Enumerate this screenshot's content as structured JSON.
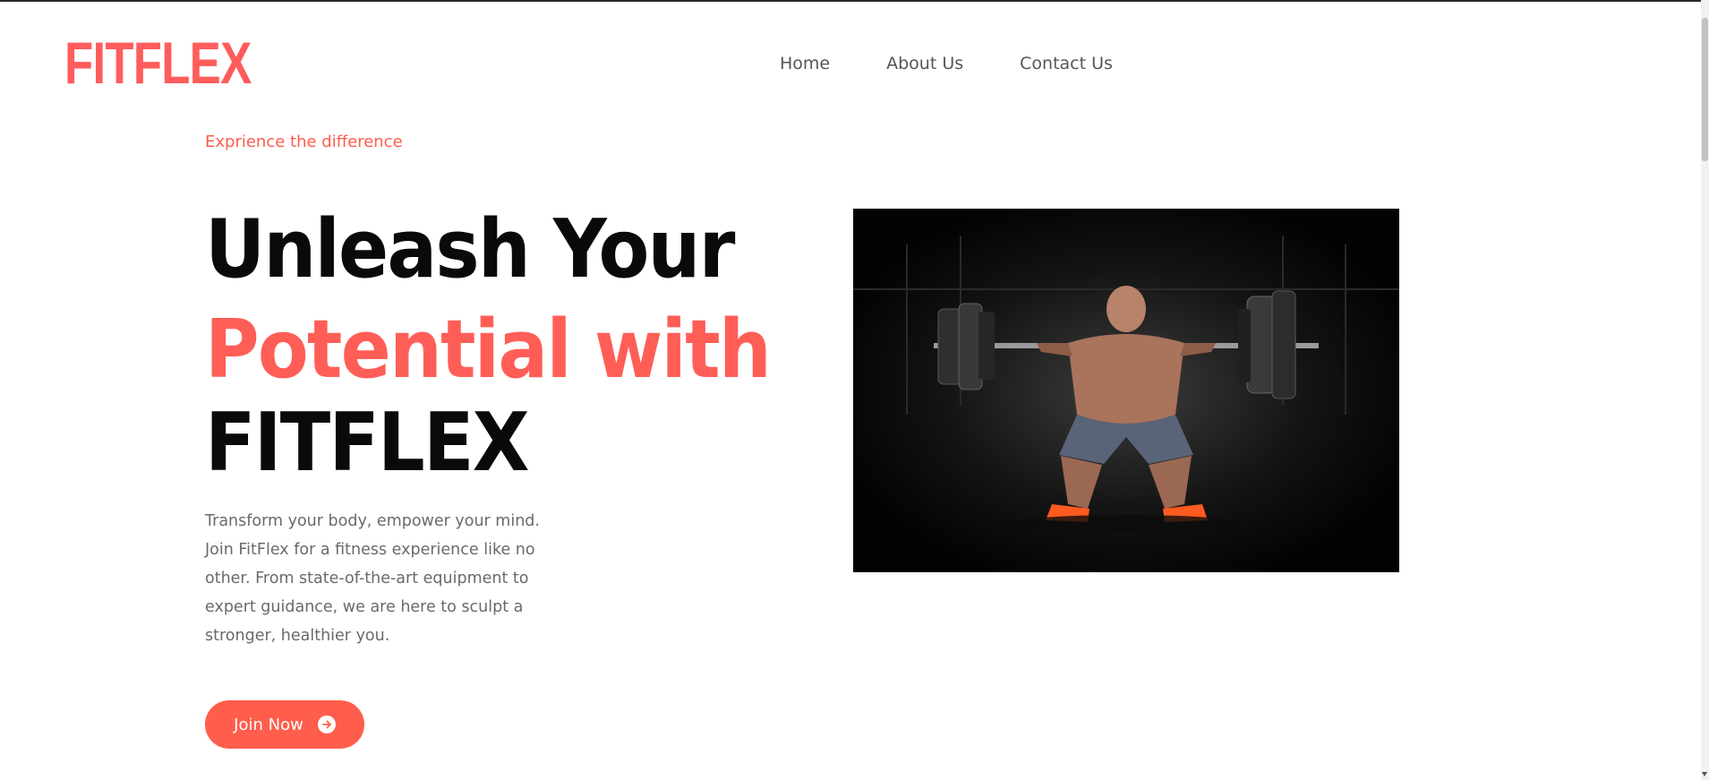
{
  "brand": {
    "logo": "FITFLEX",
    "accent_color": "#ff5e57"
  },
  "nav": {
    "items": [
      {
        "label": "Home"
      },
      {
        "label": "About Us"
      },
      {
        "label": "Contact Us"
      }
    ]
  },
  "hero": {
    "tagline": "Exprience the difference",
    "headline_line1": "Unleash Your",
    "headline_line2": "Potential with",
    "headline_line3": "FITFLEX",
    "description": "Transform your body, empower your mind. Join FitFlex for a fitness experience like no other. From state-of-the-art equipment to expert guidance, we are here to sculpt a stronger, healthier you.",
    "cta_label": "Join Now",
    "cta_icon": "arrow-right-circle-icon",
    "image_icon": "weightlifter-image"
  }
}
